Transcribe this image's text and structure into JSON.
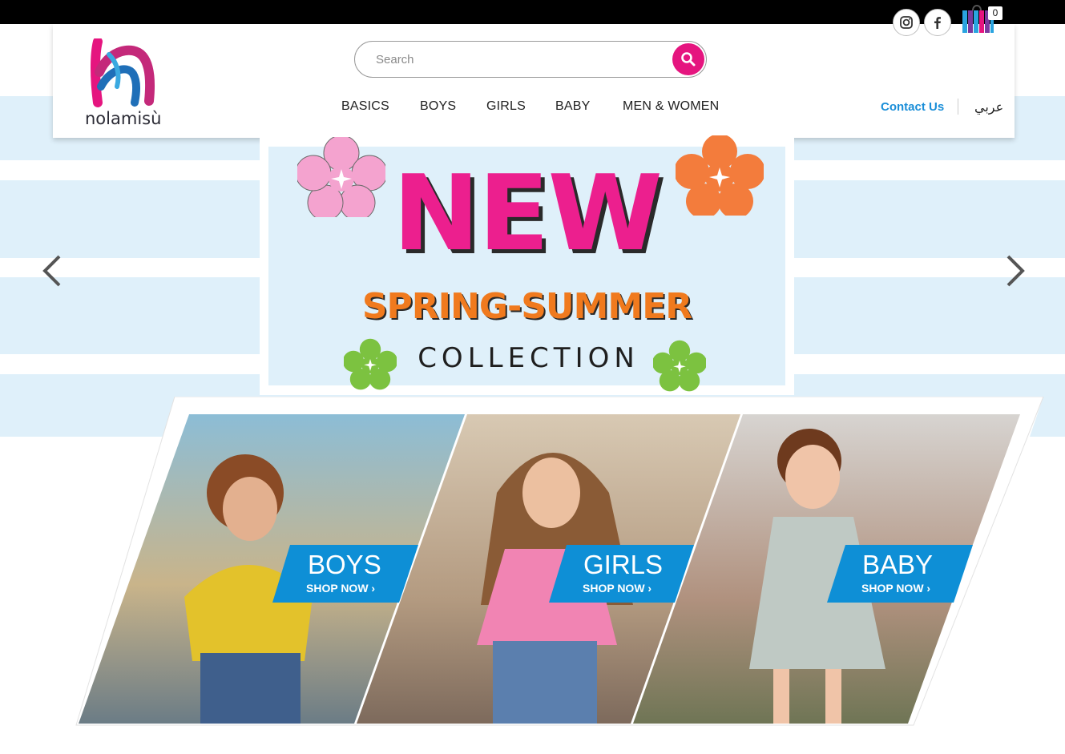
{
  "header": {
    "logo_text": "nolamisù",
    "search": {
      "placeholder": "Search"
    },
    "nav": [
      "BASICS",
      "BOYS",
      "GIRLS",
      "BABY",
      "MEN & WOMEN"
    ],
    "contact_label": "Contact Us",
    "language_label": "عربي",
    "cart_count": "0"
  },
  "social_icons": [
    "instagram-icon",
    "facebook-icon"
  ],
  "banner": {
    "headline": "NEW",
    "subheadline": "SPRING-SUMMER",
    "tagline": "COLLECTION"
  },
  "categories": [
    {
      "title": "BOYS",
      "cta": "SHOP NOW ›"
    },
    {
      "title": "GIRLS",
      "cta": "SHOP NOW ›"
    },
    {
      "title": "BABY",
      "cta": "SHOP NOW ›"
    }
  ],
  "colors": {
    "brand_pink": "#e5157f",
    "brand_blue": "#1a8ed8",
    "banner_bg": "#dff0fa",
    "orange": "#f07a1e",
    "label_blue": "#0e8fd6"
  }
}
